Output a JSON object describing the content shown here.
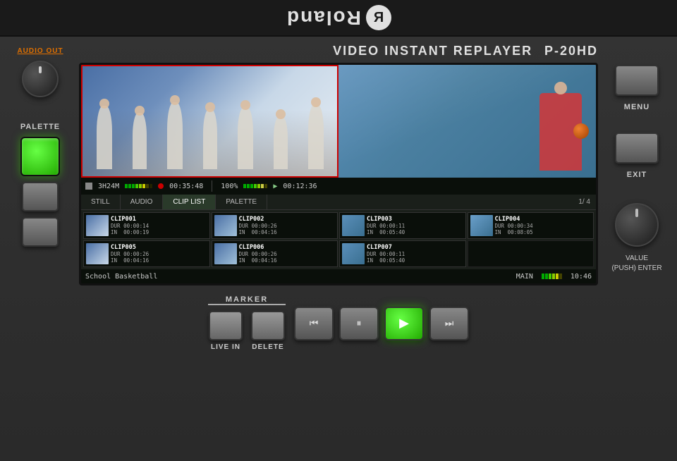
{
  "brand": {
    "name": "Roland",
    "logo_r": "R"
  },
  "device": {
    "title_prefix": "VIDEO INSTANT REPLAYER",
    "title_model": "P-20HD"
  },
  "left_controls": {
    "audio_out_label": "AUDIO OUT",
    "palette_label": "PALETTE"
  },
  "right_controls": {
    "menu_label": "MENU",
    "exit_label": "EXIT",
    "value_label": "VALUE\n(PUSH) ENTER"
  },
  "status_bar": {
    "format": "3H24M",
    "timecode": "00:35:48",
    "zoom": "100%",
    "play_time": "00:12:36"
  },
  "tabs": [
    {
      "label": "STILL",
      "active": false
    },
    {
      "label": "AUDIO",
      "active": false
    },
    {
      "label": "CLIP LIST",
      "active": true
    },
    {
      "label": "PALETTE",
      "active": false
    }
  ],
  "tab_page": "1/ 4",
  "clips": [
    {
      "name": "CLIP001",
      "dur": "00:00:14",
      "in": "00:00:19",
      "thumb": "team"
    },
    {
      "name": "CLIP002",
      "dur": "00:00:26",
      "in": "00:04:16",
      "thumb": "team"
    },
    {
      "name": "CLIP003",
      "dur": "00:00:11",
      "in": "00:05:40",
      "thumb": "player"
    },
    {
      "name": "CLIP004",
      "dur": "00:00:34",
      "in": "00:08:05",
      "thumb": "player"
    },
    {
      "name": "CLIP005",
      "dur": "00:00:26",
      "in": "00:04:16",
      "thumb": "team"
    },
    {
      "name": "CLIP006",
      "dur": "00:00:26",
      "in": "00:04:16",
      "thumb": "team"
    },
    {
      "name": "CLIP007",
      "dur": "00:00:11",
      "in": "00:05:40",
      "thumb": "player"
    }
  ],
  "info_bar": {
    "scene": "School Basketball",
    "channel": "MAIN",
    "time": "10:46"
  },
  "marker": {
    "label": "MARKER",
    "live_in_label": "LIVE IN",
    "delete_label": "DELETE"
  },
  "transport": {
    "skip_back_label": "⏮",
    "pause_label": "⏸",
    "play_label": "▶",
    "skip_forward_label": "⏭"
  }
}
